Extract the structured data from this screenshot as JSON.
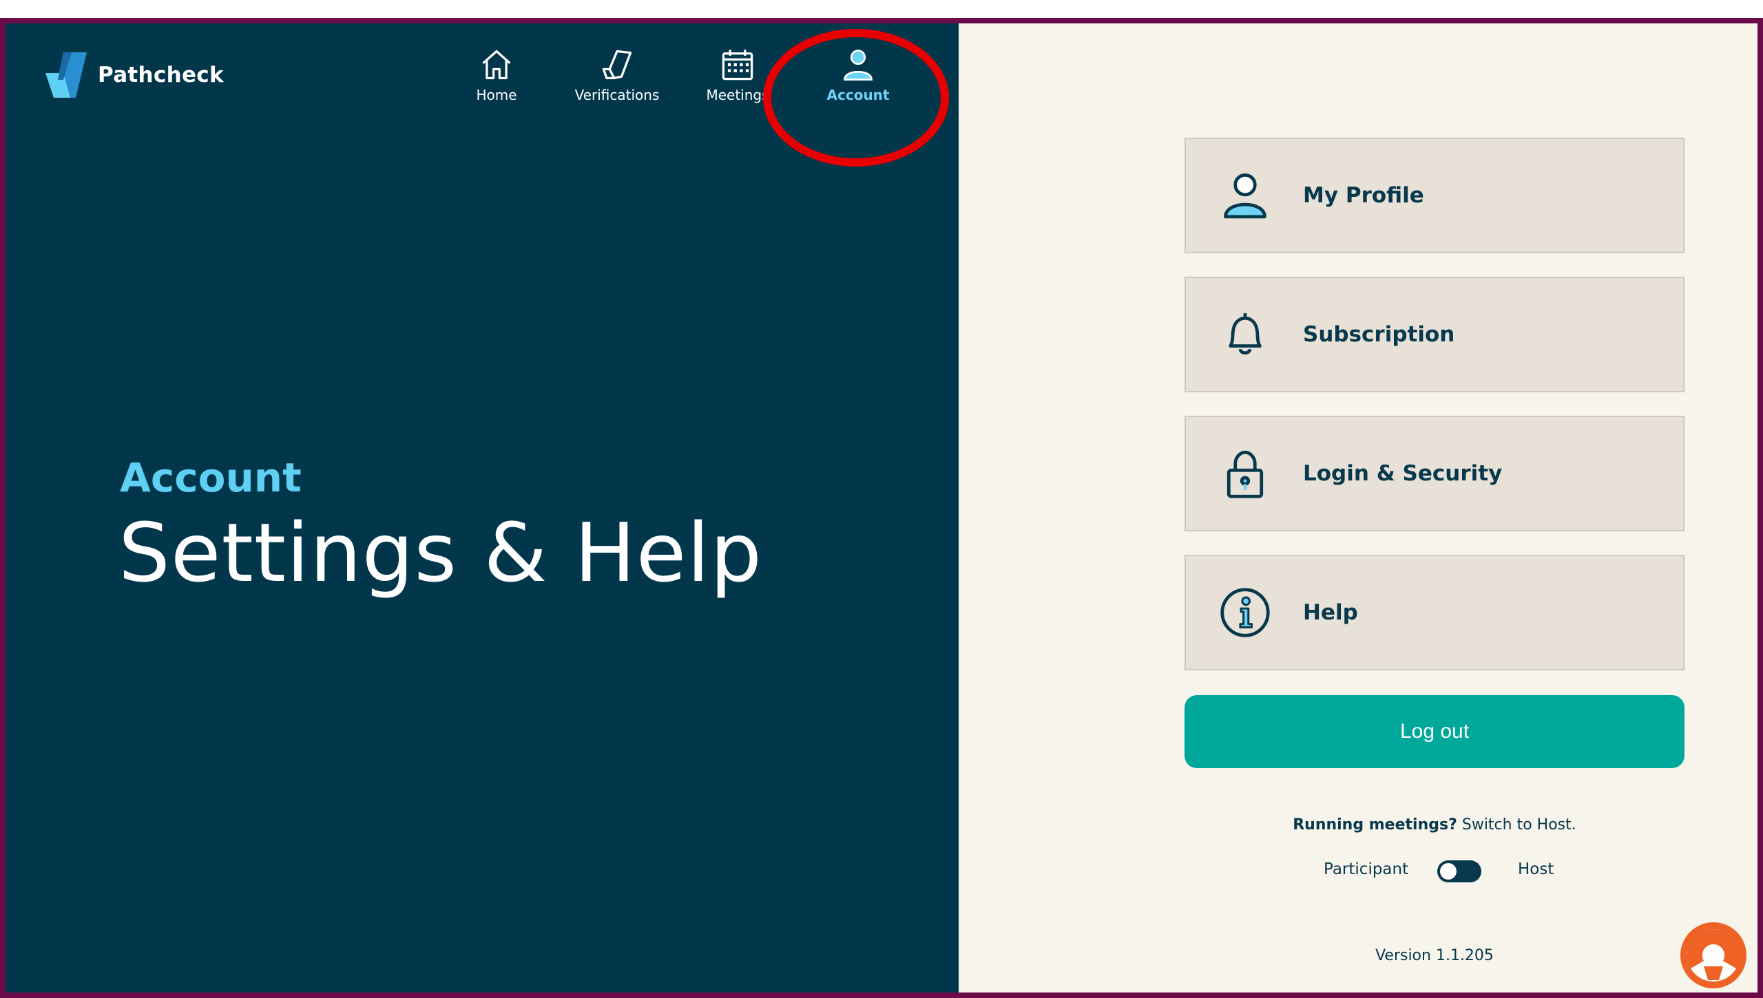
{
  "brand": {
    "name": "Pathcheck"
  },
  "nav": {
    "items": [
      {
        "label": "Home",
        "icon": "home-icon"
      },
      {
        "label": "Verifications",
        "icon": "verifications-icon"
      },
      {
        "label": "Meetings",
        "icon": "calendar-icon"
      },
      {
        "label": "Account",
        "icon": "user-icon",
        "active": true
      }
    ]
  },
  "hero": {
    "kicker": "Account",
    "title": "Settings & Help"
  },
  "menu": {
    "items": [
      {
        "label": "My Profile",
        "icon": "user-icon"
      },
      {
        "label": "Subscription",
        "icon": "bell-icon"
      },
      {
        "label": "Login & Security",
        "icon": "lock-icon"
      },
      {
        "label": "Help",
        "icon": "info-icon"
      }
    ]
  },
  "logout": {
    "label": "Log out"
  },
  "mode": {
    "question": "Running meetings?",
    "hint": "Switch to Host.",
    "left_label": "Participant",
    "right_label": "Host",
    "selected": "Participant"
  },
  "version": "Version 1.1.205",
  "colors": {
    "sidebar_bg": "#02374b",
    "accent": "#5fd0f4",
    "logout_bg": "#00a89c",
    "card_bg": "#e7e1d7",
    "frame": "#6b0b4a",
    "help_float": "#ee6325"
  }
}
